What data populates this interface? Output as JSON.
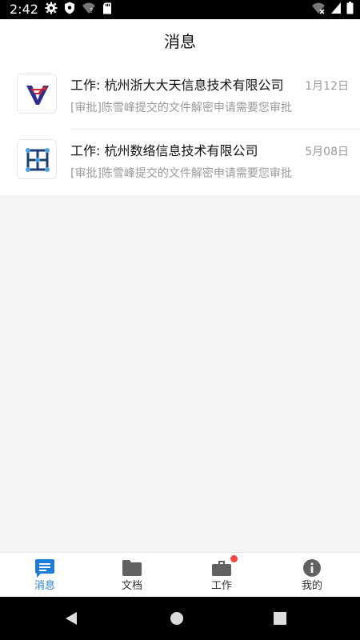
{
  "status_bar": {
    "time": "2:42",
    "left_icons": [
      "gear-icon",
      "shield-icon",
      "wifi-question-icon",
      "sd-card-icon"
    ],
    "right_icons": [
      "wifi-off-icon",
      "signal-icon",
      "battery-icon"
    ]
  },
  "header": {
    "title": "消息"
  },
  "messages": [
    {
      "title": "工作: 杭州浙大大天信息技术有限公司",
      "date": "1月12日",
      "preview": "[审批]陈雪峰提交的文件解密申请需要您审批",
      "logo": "company-logo-zdtt-icon"
    },
    {
      "title": "工作: 杭州数络信息技术有限公司",
      "date": "5月08日",
      "preview": "[审批]陈雪峰提交的文件解密申请需要您审批",
      "logo": "company-logo-shuluo-icon"
    }
  ],
  "tabs": [
    {
      "label": "消息",
      "icon": "message-icon",
      "active": true,
      "badge": false
    },
    {
      "label": "文档",
      "icon": "folder-icon",
      "active": false,
      "badge": false
    },
    {
      "label": "工作",
      "icon": "briefcase-icon",
      "active": false,
      "badge": true
    },
    {
      "label": "我的",
      "icon": "info-icon",
      "active": false,
      "badge": false
    }
  ],
  "colors": {
    "accent": "#1f7fd6",
    "badge": "#f04545",
    "background": "#f3f4f6"
  },
  "nav_bar": [
    "back-icon",
    "home-icon",
    "recents-icon"
  ]
}
